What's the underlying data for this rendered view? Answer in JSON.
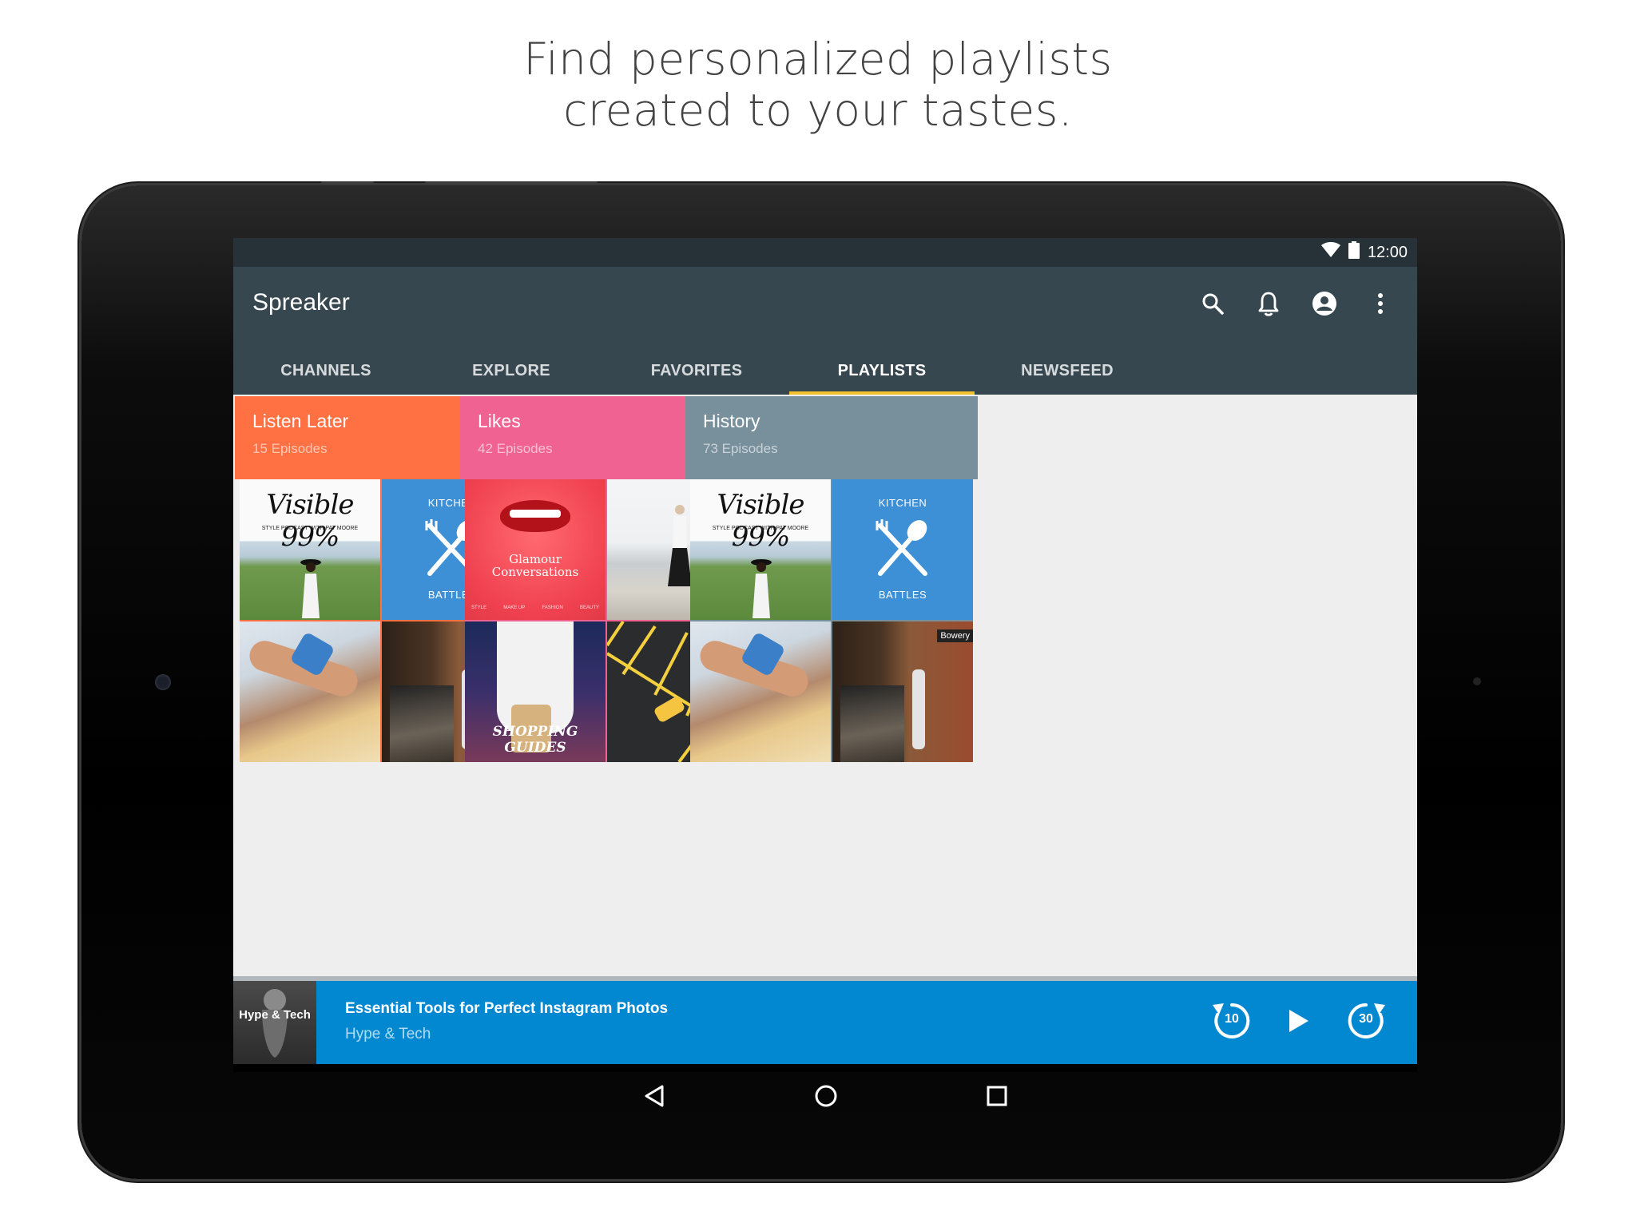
{
  "promo": {
    "line1": "Find personalized playlists",
    "line2": "created to your tastes."
  },
  "status_bar": {
    "time": "12:00",
    "icons": [
      "wifi-icon",
      "battery-icon"
    ]
  },
  "app": {
    "title": "Spreaker",
    "actions": [
      "search-icon",
      "bell-icon",
      "account-icon",
      "more-vert-icon"
    ]
  },
  "tabs": [
    {
      "label": "CHANNELS",
      "active": false
    },
    {
      "label": "EXPLORE",
      "active": false
    },
    {
      "label": "FAVORITES",
      "active": false
    },
    {
      "label": "PLAYLISTS",
      "active": true
    },
    {
      "label": "NEWSFEED",
      "active": false
    }
  ],
  "playlists": [
    {
      "title": "Listen Later",
      "subtitle": "15 Episodes",
      "color": "#ff7043",
      "tiles": [
        "visible",
        "kitchen",
        "food",
        "subway"
      ]
    },
    {
      "title": "Likes",
      "subtitle": "42 Episodes",
      "color": "#f06292",
      "tiles": [
        "glamour",
        "dune",
        "shop",
        "parking"
      ]
    },
    {
      "title": "History",
      "subtitle": "73 Episodes",
      "color": "#78909c",
      "tiles": [
        "visible",
        "kitchen",
        "food",
        "subway"
      ]
    }
  ],
  "artwork_text": {
    "visible_title": "Visible 99%",
    "visible_sub": "STYLE PODCAST WITH PAT MOORE",
    "kitchen_top": "KITCHEN",
    "kitchen_bottom": "BATTLES",
    "subway_sign": "Bowery",
    "glamour_line1": "Glamour",
    "glamour_line2": "Conversations",
    "glamour_tags": [
      "STYLE",
      "MAKE UP",
      "FASHION",
      "BEAUTY"
    ],
    "shop_title": "SHOPPING GUIDES"
  },
  "player": {
    "thumb_label": "Hype & Tech",
    "episode_title": "Essential Tools for Perfect Instagram Photos",
    "show_name": "Hype & Tech",
    "rewind_seconds": "10",
    "forward_seconds": "30",
    "progress": 0.0,
    "accent": "#0288d1"
  },
  "system_nav": [
    "back-icon",
    "home-icon",
    "recents-icon"
  ]
}
